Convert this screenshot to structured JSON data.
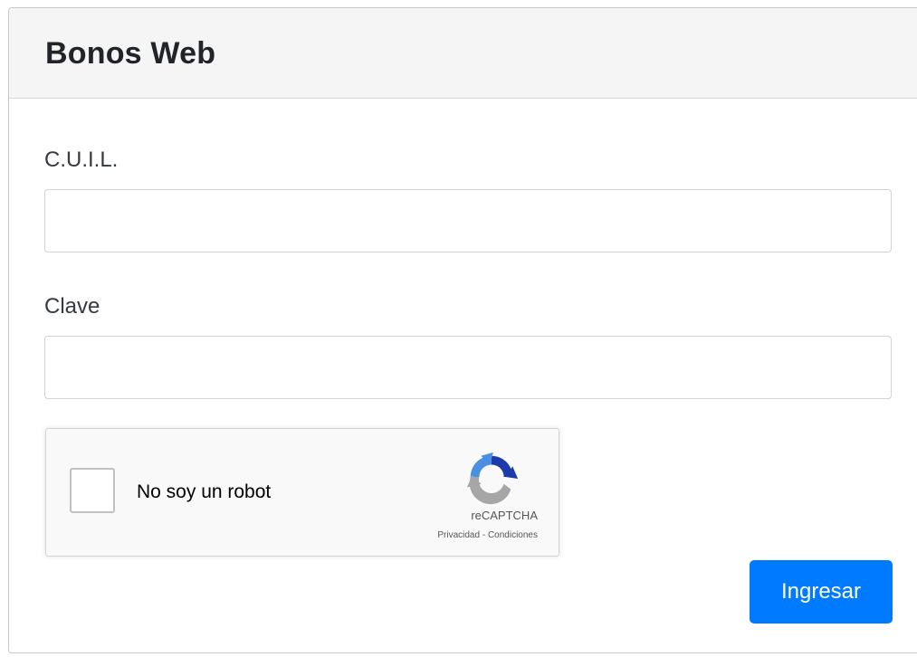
{
  "header": {
    "title": "Bonos Web"
  },
  "form": {
    "cuil": {
      "label": "C.U.I.L.",
      "value": ""
    },
    "clave": {
      "label": "Clave",
      "value": ""
    },
    "recaptcha": {
      "checkbox_label": "No soy un robot",
      "brand": "reCAPTCHA",
      "privacy_link": "Privacidad",
      "separator": " - ",
      "terms_link": "Condiciones",
      "logo_icon": "recaptcha-logo-icon",
      "checked": false
    },
    "submit_label": "Ingresar"
  },
  "colors": {
    "primary": "#007bff",
    "header_bg": "#f5f5f5",
    "recaptcha_blue": "#1c3aa9",
    "recaptcha_light_blue": "#4a90e2",
    "recaptcha_gray": "#a6a6a6"
  }
}
